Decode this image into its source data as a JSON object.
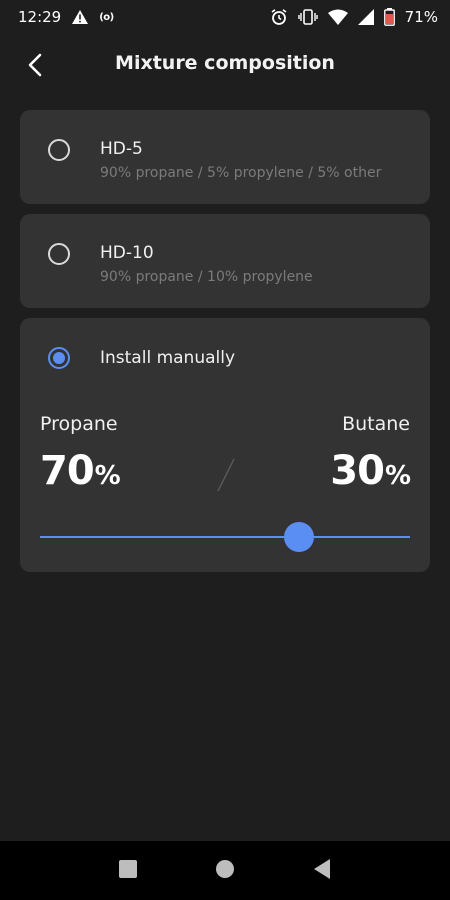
{
  "status_bar": {
    "time": "12:29",
    "nfc_label": "(o)",
    "battery_percent": "71%",
    "icons": [
      "alert-triangle-icon",
      "nfc-icon",
      "alarm-icon",
      "vibrate-icon",
      "wifi-icon",
      "signal-icon",
      "battery-icon"
    ]
  },
  "header": {
    "title": "Mixture composition",
    "back_icon": "chevron-left-icon"
  },
  "options": [
    {
      "title": "HD-5",
      "subtitle": "90% propane / 5% propylene / 5% other",
      "selected": false
    },
    {
      "title": "HD-10",
      "subtitle": "90% propane / 10% propylene",
      "selected": false
    },
    {
      "title": "Install manually",
      "selected": true
    }
  ],
  "manual": {
    "left_label": "Propane",
    "left_value": "70",
    "left_unit": "%",
    "right_label": "Butane",
    "right_value": "30",
    "right_unit": "%",
    "slider_fraction": 0.7
  },
  "nav_bar": {
    "icons": [
      "square-icon",
      "circle-icon",
      "triangle-back-icon"
    ]
  },
  "colors": {
    "accent": "#5b8ef2",
    "background": "#1e1e1e",
    "card": "#333333",
    "subtext": "#7b7b7b"
  }
}
